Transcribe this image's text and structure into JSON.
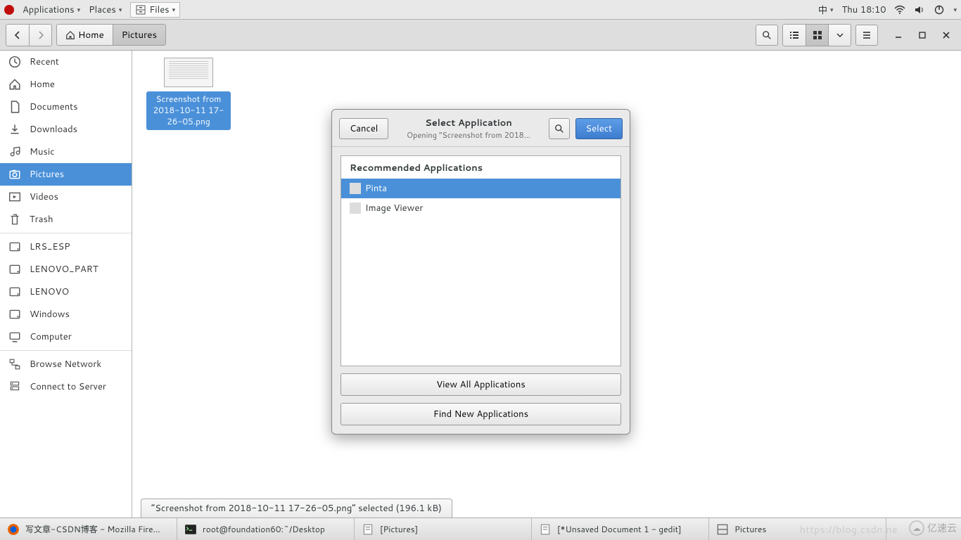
{
  "top_panel": {
    "applications": "Applications",
    "places": "Places",
    "files": "Files",
    "ime": "中",
    "clock": "Thu 18:10"
  },
  "toolbar": {
    "path_home": "Home",
    "path_current": "Pictures"
  },
  "sidebar": {
    "items": [
      {
        "label": "Recent"
      },
      {
        "label": "Home"
      },
      {
        "label": "Documents"
      },
      {
        "label": "Downloads"
      },
      {
        "label": "Music"
      },
      {
        "label": "Pictures"
      },
      {
        "label": "Videos"
      },
      {
        "label": "Trash"
      }
    ],
    "devices": [
      {
        "label": "LRS_ESP"
      },
      {
        "label": "LENOVO_PART"
      },
      {
        "label": "LENOVO"
      },
      {
        "label": "Windows"
      },
      {
        "label": "Computer"
      }
    ],
    "network": [
      {
        "label": "Browse Network"
      },
      {
        "label": "Connect to Server"
      }
    ]
  },
  "content": {
    "file_label": "Screenshot from 2018-10-11 17-26-05.png",
    "status": "“Screenshot from 2018-10-11 17-26-05.png” selected  (196.1 kB)"
  },
  "dialog": {
    "cancel": "Cancel",
    "title": "Select Application",
    "subtitle": "Opening “Screenshot from 2018…",
    "select": "Select",
    "section": "Recommended Applications",
    "apps": [
      {
        "label": "Pinta"
      },
      {
        "label": "Image Viewer"
      }
    ],
    "view_all": "View All Applications",
    "find_new": "Find New Applications"
  },
  "taskbar": {
    "items": [
      {
        "label": "写文章-CSDN博客 - Mozilla Fire..."
      },
      {
        "label": "root@foundation60:~/Desktop"
      },
      {
        "label": "[Pictures]"
      },
      {
        "label": "[*Unsaved Document 1 - gedit]"
      },
      {
        "label": "Pictures"
      }
    ],
    "faint_url": "https://blog.csdn.ne",
    "watermark": "亿速云"
  }
}
